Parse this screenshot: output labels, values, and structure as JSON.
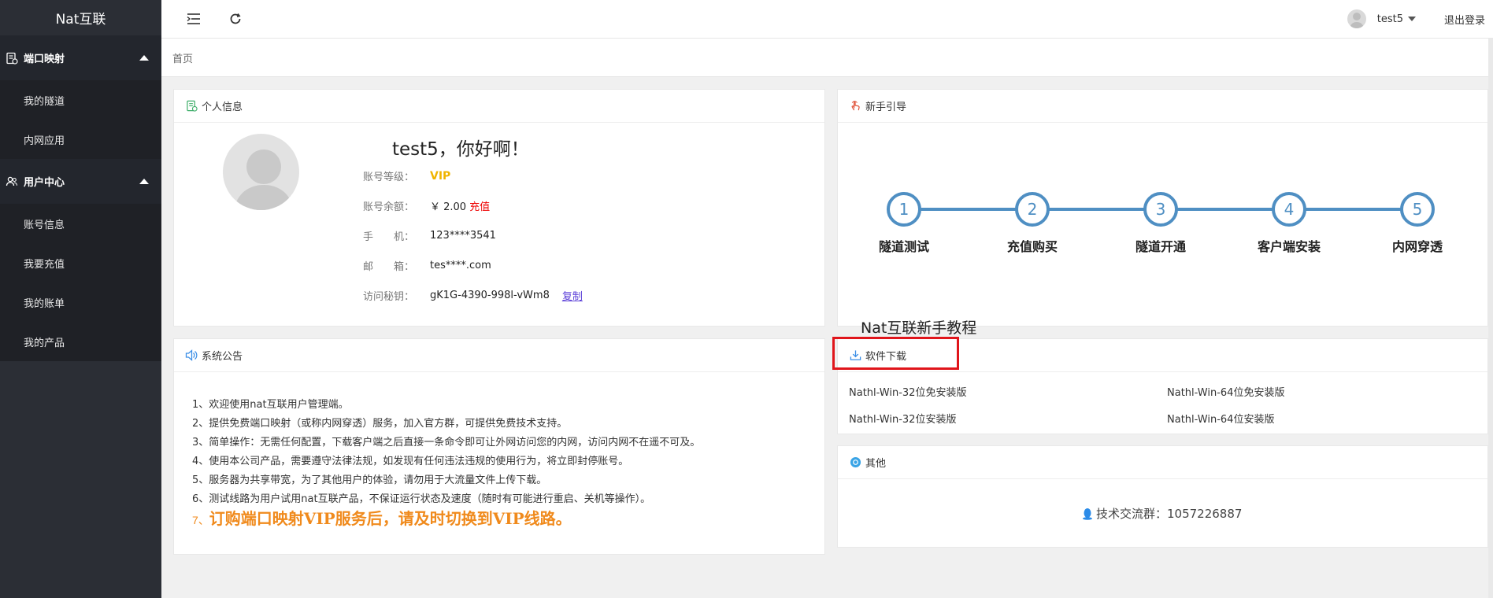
{
  "sidebar": {
    "brand": "Nat互联",
    "groups": [
      {
        "label": "端口映射",
        "items": [
          "我的隧道",
          "内网应用"
        ]
      },
      {
        "label": "用户中心",
        "items": [
          "账号信息",
          "我要充值",
          "我的账单",
          "我的产品"
        ]
      }
    ]
  },
  "header": {
    "user_name": "test5",
    "logout_label": "退出登录"
  },
  "breadcrumb": {
    "home": "首页"
  },
  "profile": {
    "title": "个人信息",
    "greeting": "test5，你好啊！",
    "level_label": "账号等级：",
    "level_value": "VIP",
    "balance_label": "账号余额：",
    "balance_value": "￥ 2.00",
    "recharge_label": "充值",
    "phone_label": "手　　机：",
    "phone_value": "123****3541",
    "email_label": "邮　　箱：",
    "email_value": "tes****.com",
    "key_label": "访问秘钥：",
    "key_value": "gK1G-4390-998l-vWm8",
    "copy_label": "复制"
  },
  "guide": {
    "title": "新手引导",
    "steps": [
      {
        "num": "1",
        "label": "隧道测试"
      },
      {
        "num": "2",
        "label": "充值购买"
      },
      {
        "num": "3",
        "label": "隧道开通"
      },
      {
        "num": "4",
        "label": "客户端安装"
      },
      {
        "num": "5",
        "label": "内网穿透"
      }
    ],
    "tutorial_title": "Nat互联新手教程"
  },
  "notice": {
    "title": "系统公告",
    "lines": [
      "1、欢迎使用nat互联用户管理端。",
      "2、提供免费端口映射（或称内网穿透）服务，加入官方群，可提供免费技术支持。",
      "3、简单操作：无需任何配置，下载客户端之后直接一条命令即可让外网访问您的内网，访问内网不在遥不可及。",
      "4、使用本公司产品，需要遵守法律法规，如发现有任何违法违规的使用行为，将立即封停账号。",
      "5、服务器为共享带宽，为了其他用户的体验，请勿用于大流量文件上传下载。",
      "6、测试线路为用户试用nat互联产品，不保证运行状态及速度（随时有可能进行重启、关机等操作）。"
    ],
    "highlight_prefix": "7、",
    "highlight": "订购端口映射VIP服务后，请及时切换到VIP线路。"
  },
  "download": {
    "title": "软件下载",
    "links": [
      "Nathl-Win-32位免安装版",
      "Nathl-Win-64位免安装版",
      "Nathl-Win-32位安装版",
      "Nathl-Win-64位安装版"
    ]
  },
  "other": {
    "title": "其他",
    "qq_text": "技术交流群：1057226887"
  },
  "colors": {
    "sidebar_bg": "#2b2e35",
    "step_blue": "#4f8fc3",
    "vip_gold": "#f0b400",
    "notice_orange": "#f08a1c",
    "highlight_red": "#e0151b"
  }
}
